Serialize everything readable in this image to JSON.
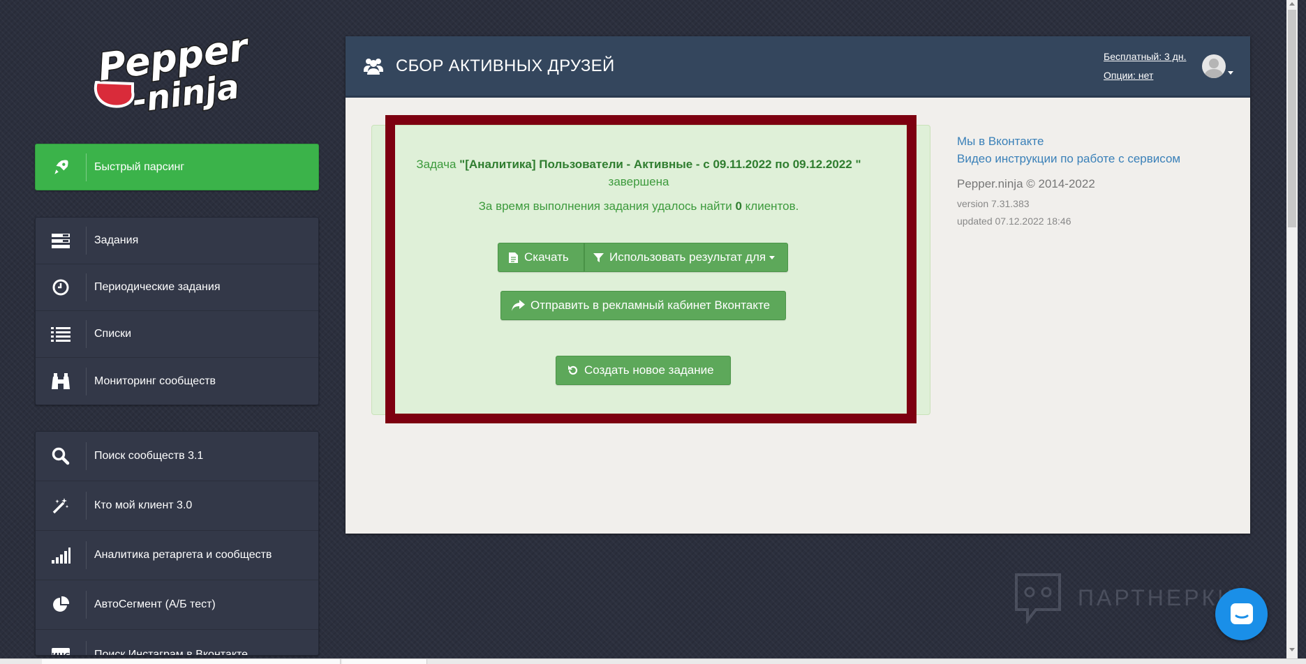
{
  "brand": {
    "logo_line1": "Pepper",
    "logo_line2": "-ninja"
  },
  "sidebar": {
    "quick": {
      "label": "Быстрый парсинг",
      "icon": "rocket-icon"
    },
    "group1": [
      {
        "label": "Задания",
        "icon": "tasks-icon"
      },
      {
        "label": "Периодические задания",
        "icon": "clock-icon"
      },
      {
        "label": "Списки",
        "icon": "list-icon"
      },
      {
        "label": "Мониторинг сообществ",
        "icon": "binoculars-icon"
      }
    ],
    "group2": [
      {
        "label": "Поиск сообществ 3.1",
        "icon": "search-icon"
      },
      {
        "label": "Кто мой клиент 3.0",
        "icon": "magic-wand-icon"
      },
      {
        "label": "Аналитика ретаргета и сообществ",
        "icon": "signal-bars-icon"
      },
      {
        "label": "АвтоСегмент (А/Б тест)",
        "icon": "pie-chart-icon"
      },
      {
        "label": "Поиск Инстаграм в Вконтакте",
        "icon": "instagram-vk-icon"
      }
    ]
  },
  "header": {
    "title": "СБОР АКТИВНЫХ ДРУЗЕЙ",
    "icon": "users-icon",
    "plan": "Бесплатный: 3 дн.",
    "options": "Опции: нет"
  },
  "result": {
    "prefix": "Задача ",
    "task_name": "\"[Аналитика] Пользователи - Активные - с 09.11.2022 по 09.12.2022 \"",
    "status": "завершена",
    "found_prefix": "За время выполнения задания удалось найти ",
    "found_count": "0",
    "found_suffix": " клиентов.",
    "download_label": "Скачать",
    "use_result_label": "Использовать результат для",
    "send_label": "Отправить в рекламный кабинет Вконтакте",
    "new_task_label": "Создать новое задание"
  },
  "info": {
    "vk_link": "Мы в Вконтакте",
    "video_link": "Видео инструкции по работе с сервисом",
    "copyright": "Pepper.ninja © 2014-2022",
    "version": "version 7.31.383",
    "updated": "updated 07.12.2022 18:46"
  },
  "watermark": "ПАРТНЕРКИН",
  "colors": {
    "accent_green": "#3bb34a",
    "header_blue": "#34465d",
    "highlight_red": "#7d0010",
    "result_bg": "#dff0d8"
  }
}
